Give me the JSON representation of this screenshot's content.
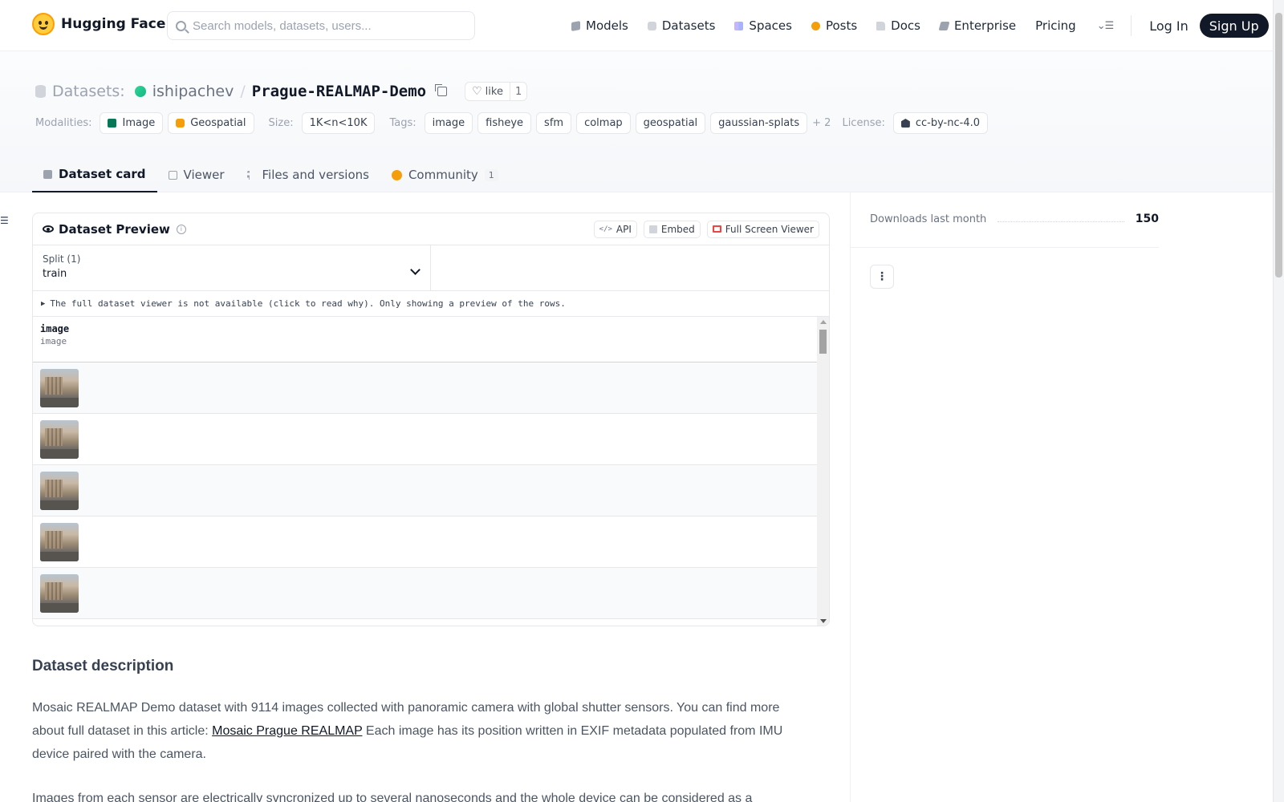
{
  "nav": {
    "brand": "Hugging Face",
    "search_placeholder": "Search models, datasets, users...",
    "items": [
      {
        "label": "Models",
        "icon": "cube-icon"
      },
      {
        "label": "Datasets",
        "icon": "database-icon"
      },
      {
        "label": "Spaces",
        "icon": "grid-icon"
      },
      {
        "label": "Posts",
        "icon": "posts-icon"
      },
      {
        "label": "Docs",
        "icon": "docs-icon"
      },
      {
        "label": "Enterprise",
        "icon": "enterprise-icon"
      },
      {
        "label": "Pricing"
      }
    ],
    "login": "Log In",
    "signup": "Sign Up"
  },
  "repo": {
    "section": "Datasets:",
    "owner": "ishipachev",
    "separator": "/",
    "name": "Prague-REALMAP-Demo",
    "like_label": "like",
    "like_count": "1"
  },
  "tags": {
    "modalities_label": "Modalities:",
    "modalities": [
      "Image",
      "Geospatial"
    ],
    "size_label": "Size:",
    "size": "1K<n<10K",
    "tags_label": "Tags:",
    "tags": [
      "image",
      "fisheye",
      "sfm",
      "colmap",
      "geospatial",
      "gaussian-splats"
    ],
    "more": "+ 2",
    "license_label": "License:",
    "license": "cc-by-nc-4.0"
  },
  "tabs": [
    {
      "label": "Dataset card",
      "active": true
    },
    {
      "label": "Viewer"
    },
    {
      "label": "Files and versions"
    },
    {
      "label": "Community",
      "badge": "1"
    }
  ],
  "preview": {
    "title": "Dataset Preview",
    "buttons": {
      "api": "API",
      "embed": "Embed",
      "fullscreen": "Full Screen Viewer"
    },
    "split_label": "Split (1)",
    "split_value": "train",
    "notice": "The full dataset viewer is not available (click to read why). Only showing a preview of the rows.",
    "column_name": "image",
    "column_type": "image",
    "rows": 5
  },
  "description": {
    "title": "Dataset description",
    "p1_before": "Mosaic REALMAP Demo dataset with 9114 images collected with panoramic camera with global shutter sensors. You can find more about full dataset in this article: ",
    "p1_link": "Mosaic Prague REALMAP",
    "p1_after": " Each image has its position written in EXIF metadata populated from IMU device paired with the camera.",
    "p2": "Images from each sensor are electrically syncronized up to several nanoseconds and the whole device can be considered as a"
  },
  "sidebar": {
    "downloads_label": "Downloads last month",
    "downloads_value": "150"
  }
}
